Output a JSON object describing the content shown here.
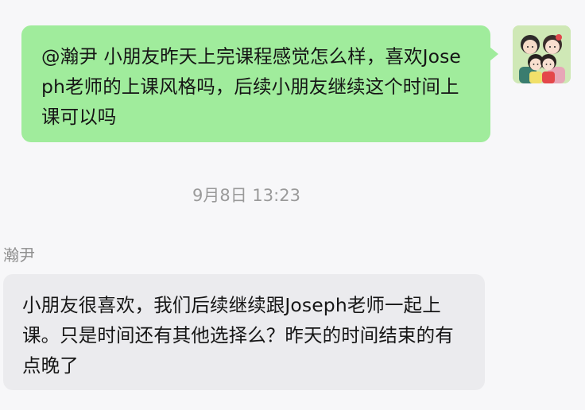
{
  "outgoing": {
    "text": "@瀚尹 小朋友昨天上完课程感觉怎么样，喜欢Joseph老师的上课风格吗，后续小朋友继续这个时间上课可以吗"
  },
  "timestamp": "9月8日 13:23",
  "incoming": {
    "sender": "瀚尹",
    "text": "小朋友很喜欢，我们后续继续跟Joseph老师一起上课。只是时间还有其他选择么？昨天的时间结束的有点晚了"
  },
  "colors": {
    "outgoing_bubble": "#a0ec9c",
    "incoming_bubble": "#ebebee",
    "background": "#f7f7f9",
    "meta_text": "#9a9a9a"
  },
  "icons": {
    "avatar": "family-cartoon-avatar-icon"
  }
}
